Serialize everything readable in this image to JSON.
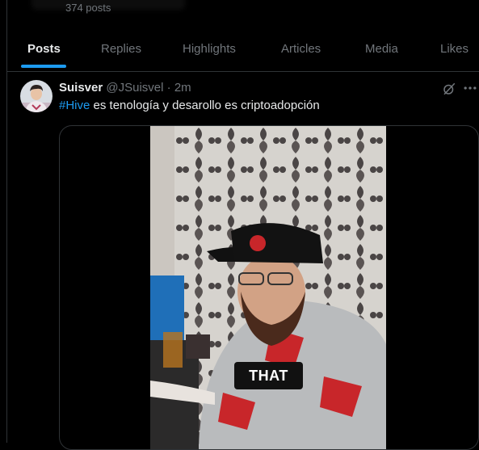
{
  "profile": {
    "posts_count": "374 posts"
  },
  "tabs": [
    {
      "label": "Posts",
      "active": true
    },
    {
      "label": "Replies"
    },
    {
      "label": "Highlights"
    },
    {
      "label": "Articles"
    },
    {
      "label": "Media"
    },
    {
      "label": "Likes"
    }
  ],
  "tweet": {
    "author": "Suisver",
    "handle": "@JSuisvel",
    "separator": "·",
    "time": "2m",
    "hashtag": "#Hive",
    "text": " es tenología y desarollo es criptoadopción",
    "media": {
      "caption": "THAT"
    }
  },
  "colors": {
    "accent": "#1d9bf0",
    "background": "#000000",
    "muted": "#71767b",
    "border": "#2f3336"
  },
  "icons": {
    "grok": "grok-icon",
    "more": "more-icon"
  }
}
